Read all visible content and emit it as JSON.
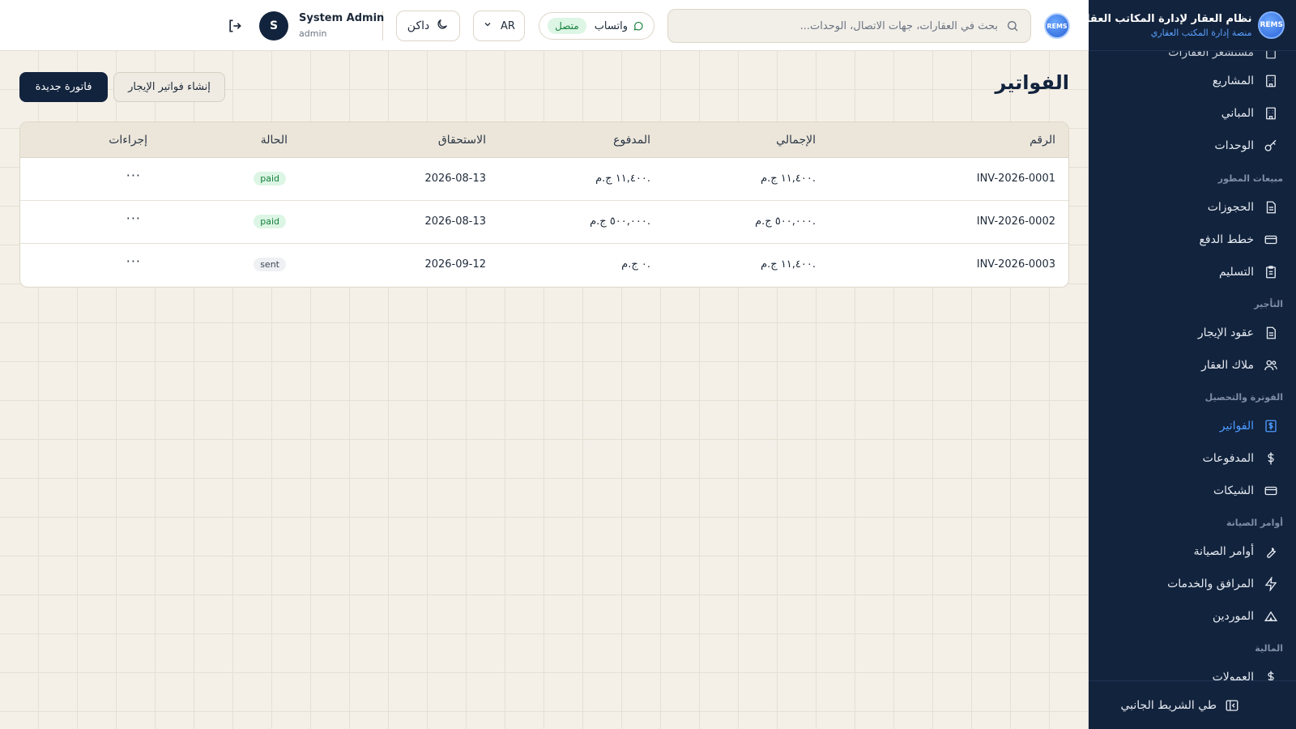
{
  "app": {
    "brand_title": "نظام العقار لإدارة المكاتب العقارية",
    "brand_subtitle": "منصة إدارة المكتب العقاري",
    "logo_text": "REMS"
  },
  "topbar": {
    "search_placeholder": "بحث في العقارات، جهات الاتصال، الوحدات...",
    "whatsapp_label": "واتساب",
    "whatsapp_status": "متصل",
    "language": "AR",
    "theme_label": "داكن",
    "user_name": "System Admin",
    "user_role": "admin",
    "user_initial": "S"
  },
  "sidebar": {
    "partial_top_item": "مستشعر العقارات",
    "items": [
      {
        "label": "المشاريع",
        "icon": "building-icon"
      },
      {
        "label": "المباني",
        "icon": "building-icon"
      },
      {
        "label": "الوحدات",
        "icon": "key-icon"
      },
      {
        "label": "الحجوزات",
        "icon": "document-icon"
      },
      {
        "label": "خطط الدفع",
        "icon": "card-icon"
      },
      {
        "label": "التسليم",
        "icon": "clipboard-icon"
      },
      {
        "label": "عقود الإيجار",
        "icon": "document-icon"
      },
      {
        "label": "ملاك العقار",
        "icon": "users-icon"
      },
      {
        "label": "الفواتير",
        "icon": "invoice-icon",
        "active": true
      },
      {
        "label": "المدفوعات",
        "icon": "dollar-icon"
      },
      {
        "label": "الشيكات",
        "icon": "card-icon"
      },
      {
        "label": "أوامر الصيانة",
        "icon": "wrench-icon"
      },
      {
        "label": "المرافق والخدمات",
        "icon": "bolt-icon"
      },
      {
        "label": "الموردين",
        "icon": "tent-icon"
      },
      {
        "label": "العمولات",
        "icon": "dollar-icon"
      }
    ],
    "sections": {
      "developer_sales": "مبيعات المطور",
      "leasing": "التأجير",
      "billing": "الفوترة والتحصيل",
      "maintenance": "أوامر الصيانة",
      "finance": "المالية"
    },
    "collapse_label": "طي الشريط الجانبي"
  },
  "page": {
    "title": "الفواتير",
    "new_invoice_button": "فاتورة جديدة",
    "generate_rent_button": "إنشاء فواتير الإيجار"
  },
  "table": {
    "columns": {
      "number": "الرقم",
      "total": "الإجمالي",
      "paid": "المدفوع",
      "due": "الاستحقاق",
      "status": "الحالة",
      "actions": "إجراءات"
    },
    "rows": [
      {
        "number": "INV-2026-0001",
        "total": "١١,٤٠٠ ج.م.",
        "paid": "١١,٤٠٠ ج.م.",
        "due": "2026-08-13",
        "status": "paid",
        "actions": "···"
      },
      {
        "number": "INV-2026-0002",
        "total": "٥٠٠,٠٠٠ ج.م.",
        "paid": "٥٠٠,٠٠٠ ج.م.",
        "due": "2026-08-13",
        "status": "paid",
        "actions": "···"
      },
      {
        "number": "INV-2026-0003",
        "total": "١١,٤٠٠ ج.م.",
        "paid": "٠ ج.م.",
        "due": "2026-09-12",
        "status": "sent",
        "actions": "···"
      }
    ]
  },
  "colors": {
    "sidebar_bg": "#12233d",
    "accent": "#4d9bff",
    "primary_button": "#12233d",
    "paid_badge": "#dcf5e4",
    "background": "#f4f0e8"
  }
}
